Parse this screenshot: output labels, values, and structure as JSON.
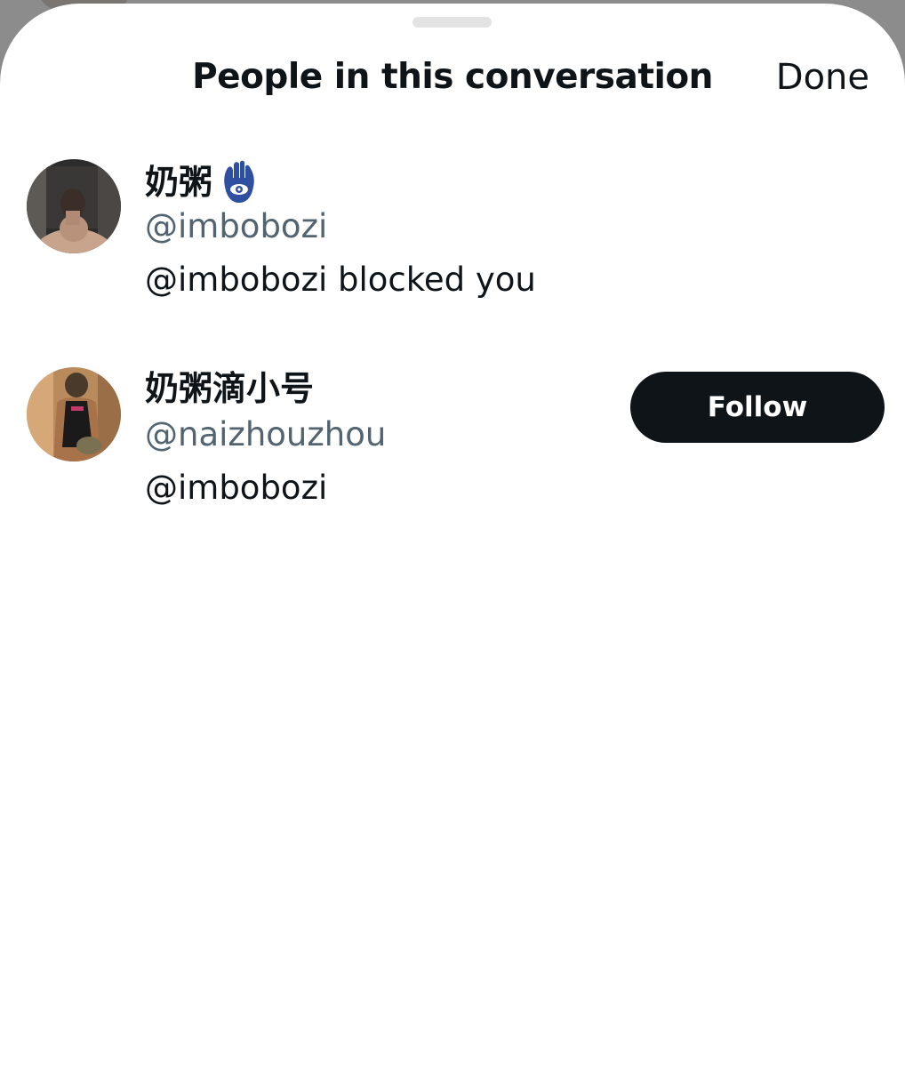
{
  "header": {
    "title": "People in this conversation",
    "done_label": "Done"
  },
  "people": [
    {
      "display_name": "奶粥",
      "badge_icon": "hamsa-hand-icon",
      "handle": "@imbobozi",
      "bio": "@imbobozi blocked you",
      "follow_label": null
    },
    {
      "display_name": "奶粥滴小号",
      "handle": "@naizhouzhou",
      "bio": "@imbobozi",
      "follow_label": "Follow"
    }
  ],
  "colors": {
    "text_primary": "#0f1419",
    "text_secondary": "#536471",
    "button_bg": "#0f1419",
    "button_text": "#ffffff",
    "badge_blue": "#2f4fa0"
  }
}
